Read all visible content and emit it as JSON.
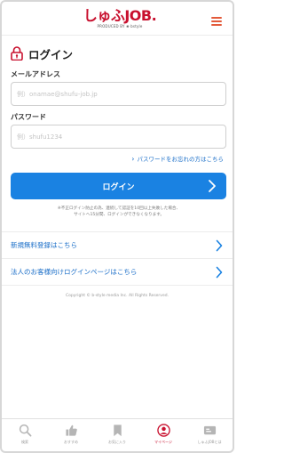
{
  "header": {
    "logo_text": "しゅふJOB.",
    "logo_sub": "PRODUCED BY ❀ bstyle"
  },
  "page": {
    "title": "ログイン"
  },
  "form": {
    "email_label": "メールアドレス",
    "email_placeholder": "例）onamae@shufu-job.jp",
    "password_label": "パスワード",
    "password_placeholder": "例）shufu1234",
    "forgot_link": "パスワードをお忘れの方はこちら",
    "login_button": "ログイン",
    "notice_line1": "※不正ログイン防止の為、連続して認証を10回以上失敗した場合、",
    "notice_line2": "サイトへ15分間、ログインができなくなります。"
  },
  "links": {
    "register": "新規無料登録はこちら",
    "corporate": "法人のお客様向けログインページはこちら"
  },
  "footer": {
    "copyright": "Copyright © b-style media Inc. All Rights Reserved."
  },
  "tabbar": {
    "tabs": [
      {
        "label": "検索",
        "icon": "search-icon"
      },
      {
        "label": "おすすめ",
        "icon": "thumbs-up-icon"
      },
      {
        "label": "お気に入り",
        "icon": "bookmark-icon"
      },
      {
        "label": "マイページ",
        "icon": "user-icon"
      },
      {
        "label": "しゅふJOBとは",
        "icon": "info-card-icon"
      }
    ]
  },
  "colors": {
    "brand_red": "#c8102e",
    "accent_blue": "#1a82e2",
    "link_blue": "#1a6ec8",
    "menu_orange": "#e35a3a"
  }
}
